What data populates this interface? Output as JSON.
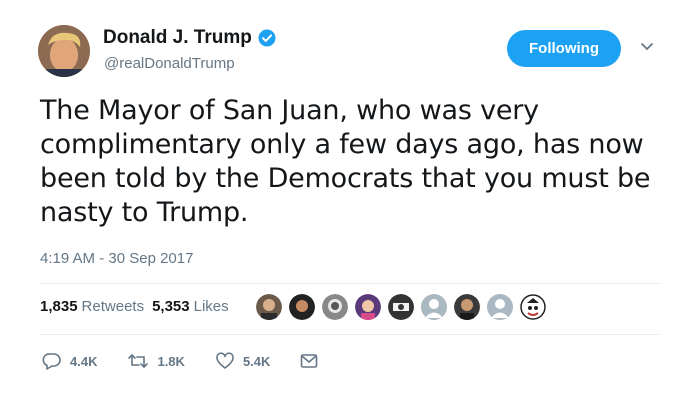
{
  "author": {
    "name": "Donald J. Trump",
    "handle": "@realDonaldTrump",
    "verified": true
  },
  "follow_button": {
    "label": "Following"
  },
  "tweet": {
    "text": "The Mayor of San Juan, who was very complimentary only a few days ago, has now been told by the Democrats that you must be nasty to Trump.",
    "timestamp": "4:19 AM - 30 Sep 2017"
  },
  "stats": {
    "retweets_count": "1,835",
    "retweets_label": "Retweets",
    "likes_count": "5,353",
    "likes_label": "Likes"
  },
  "actions": {
    "reply_count": "4.4K",
    "retweet_count": "1.8K",
    "like_count": "5.4K"
  },
  "icons": [
    "verified-badge-icon",
    "chevron-down-icon",
    "reply-icon",
    "retweet-icon",
    "heart-icon",
    "message-icon"
  ],
  "colors": {
    "accent": "#1da1f2",
    "text": "#14171a",
    "secondary": "#657786",
    "divider": "#e6ecf0"
  }
}
